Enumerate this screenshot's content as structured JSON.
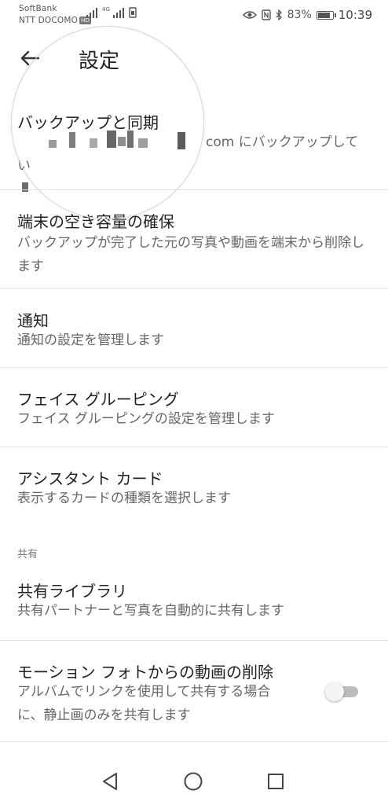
{
  "status_bar": {
    "carrier_1": "SoftBank",
    "carrier_2": "NTT DOCOMO",
    "hd_badge": "HD",
    "network_type": "4G",
    "battery": "83%",
    "time": "10:39"
  },
  "app_bar": {
    "back_icon": "arrow-left-icon",
    "title": "設定"
  },
  "items": [
    {
      "title": "バックアップと同期",
      "subtitle_suffix": "com にバックアップしてい"
    },
    {
      "title": "端末の空き容量の確保",
      "subtitle": "バックアップが完了した元の写真や動画を端末から削除します"
    },
    {
      "title": "通知",
      "subtitle": "通知の設定を管理します"
    },
    {
      "title": "フェイス グルーピング",
      "subtitle": "フェイス グルーピングの設定を管理します"
    },
    {
      "title": "アシスタント カード",
      "subtitle": "表示するカードの種類を選択します"
    }
  ],
  "section_header": "共有",
  "shared_items": [
    {
      "title": "共有ライブラリ",
      "subtitle": "共有パートナーと写真を自動的に共有します"
    },
    {
      "title": "モーション フォトからの動画の削除",
      "subtitle": "アルバムでリンクを使用して共有する場合に、静止画のみを共有します",
      "toggle_on": false
    }
  ],
  "nav_bar": {
    "back": "triangle-back-icon",
    "home": "circle-home-icon",
    "recents": "square-recents-icon"
  }
}
